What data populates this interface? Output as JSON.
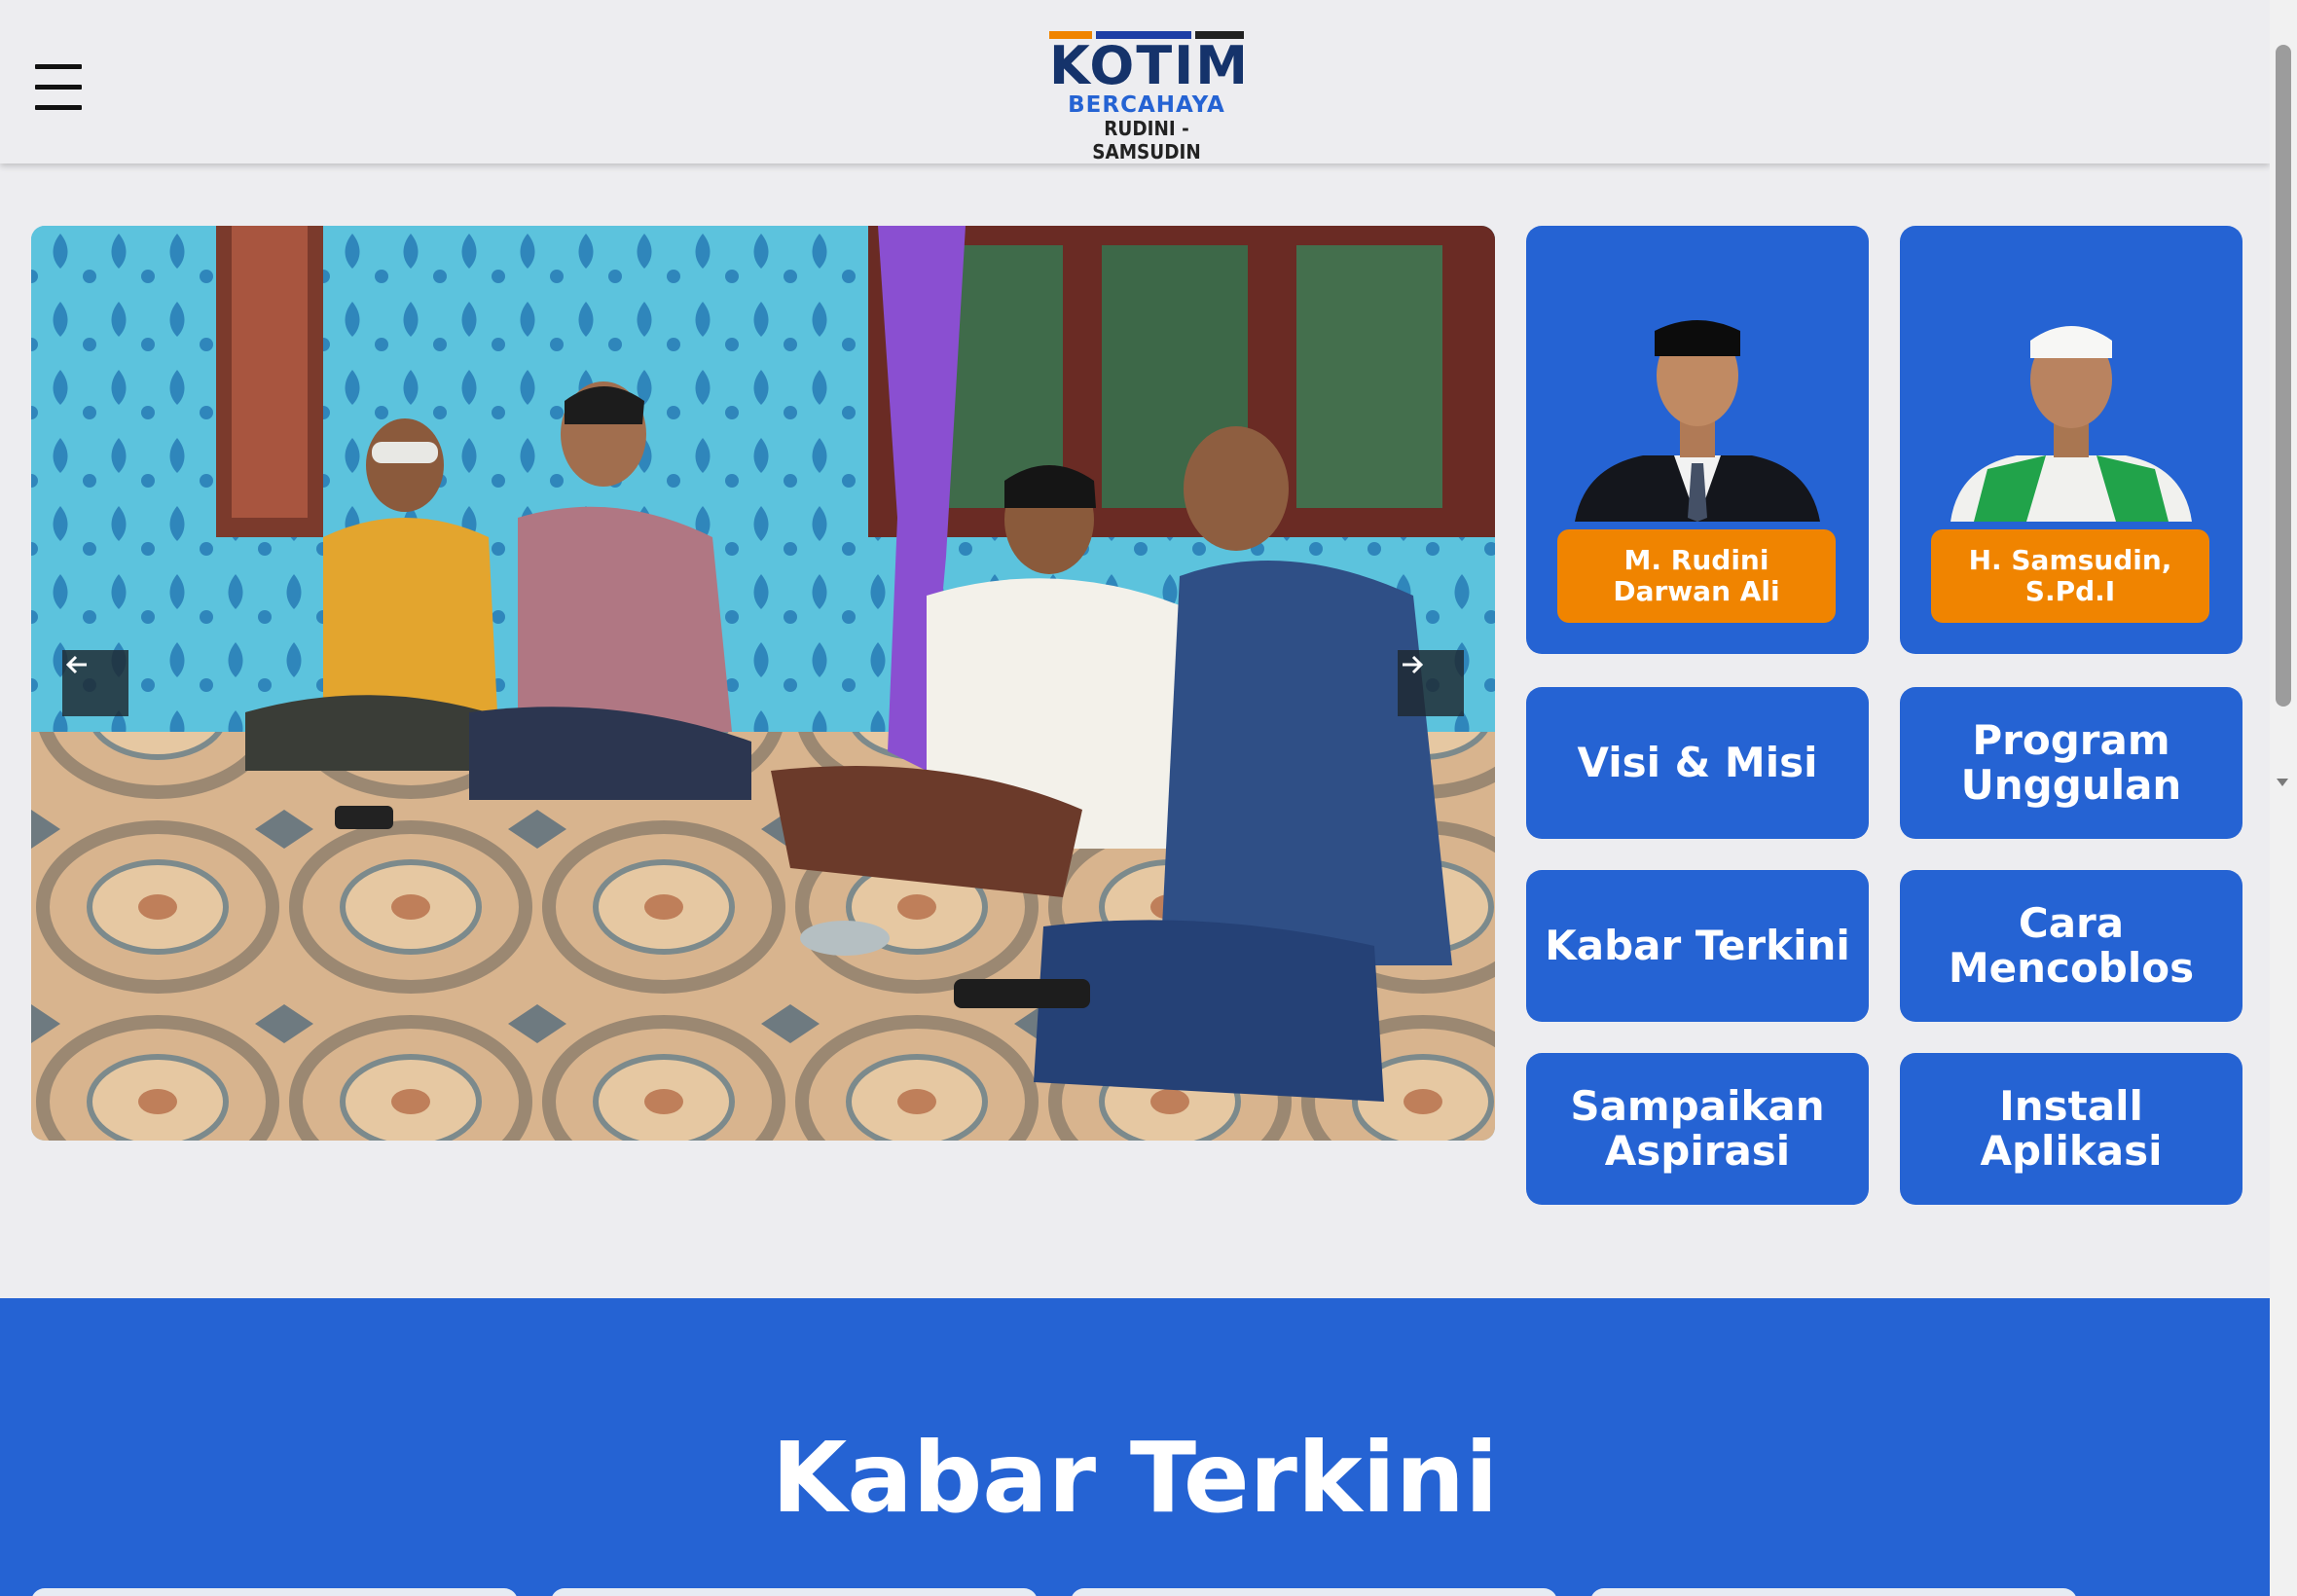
{
  "header": {
    "logo": {
      "line1": "KOTIM",
      "line2": "BERCAHAYA",
      "line3": "RUDINI - SAMSUDIN"
    }
  },
  "slider": {
    "prev_icon": "arrow-left-icon",
    "next_icon": "arrow-right-icon"
  },
  "candidates": [
    {
      "name": "M. Rudini Darwan Ali"
    },
    {
      "name": "H. Samsudin, S.Pd.I"
    }
  ],
  "menu": [
    {
      "label": "Visi & Misi"
    },
    {
      "label": "Program Unggulan"
    },
    {
      "label": "Kabar Terkini"
    },
    {
      "label": "Cara Mencoblos"
    },
    {
      "label": "Sampaikan Aspirasi"
    },
    {
      "label": "Install Aplikasi"
    }
  ],
  "news_section": {
    "title": "Kabar Terkini"
  },
  "colors": {
    "brand_blue": "#2563d3",
    "accent_orange": "#f08400",
    "page_bg": "#ededf0"
  }
}
